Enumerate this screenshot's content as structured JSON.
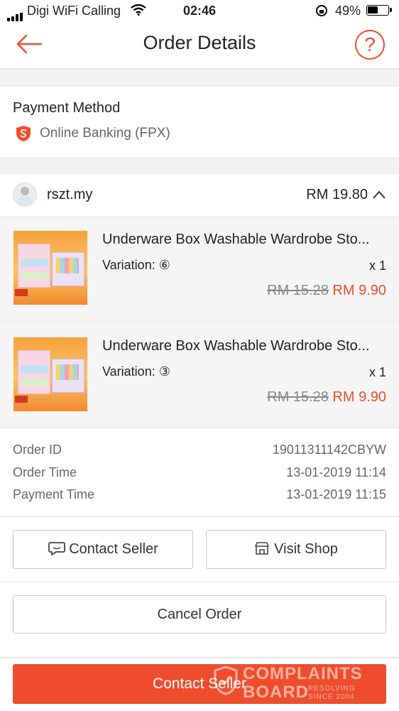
{
  "status_bar": {
    "carrier": "Digi WiFi Calling",
    "time": "02:46",
    "battery": "49%"
  },
  "header": {
    "title": "Order Details",
    "help_symbol": "?"
  },
  "payment": {
    "heading": "Payment Method",
    "method": "Online Banking (FPX)"
  },
  "shop": {
    "name": "rszt.my",
    "total": "RM 19.80"
  },
  "items": [
    {
      "name": "Underware Box Washable Wardrobe Sto...",
      "variation": "Variation: ⑥",
      "quantity": "x 1",
      "original_price": "RM 15.28",
      "price": "RM 9.90"
    },
    {
      "name": "Underware Box Washable Wardrobe Sto...",
      "variation": "Variation: ③",
      "quantity": "x 1",
      "original_price": "RM 15.28",
      "price": "RM 9.90"
    }
  ],
  "order_info": {
    "order_id_label": "Order ID",
    "order_id": "19011311142CBYW",
    "order_time_label": "Order Time",
    "order_time": "13-01-2019 11:14",
    "payment_time_label": "Payment Time",
    "payment_time": "13-01-2019 11:15"
  },
  "actions": {
    "contact_seller": "Contact Seller",
    "visit_shop": "Visit Shop",
    "cancel_order": "Cancel Order",
    "bottom_contact_seller": "Contact Seller"
  },
  "watermark": {
    "line1": "COMPLAINTS",
    "line2": "BOARD",
    "tag1": "RESOLVING",
    "tag2": "SINCE 2004"
  },
  "colors": {
    "accent": "#ee4d2d"
  }
}
